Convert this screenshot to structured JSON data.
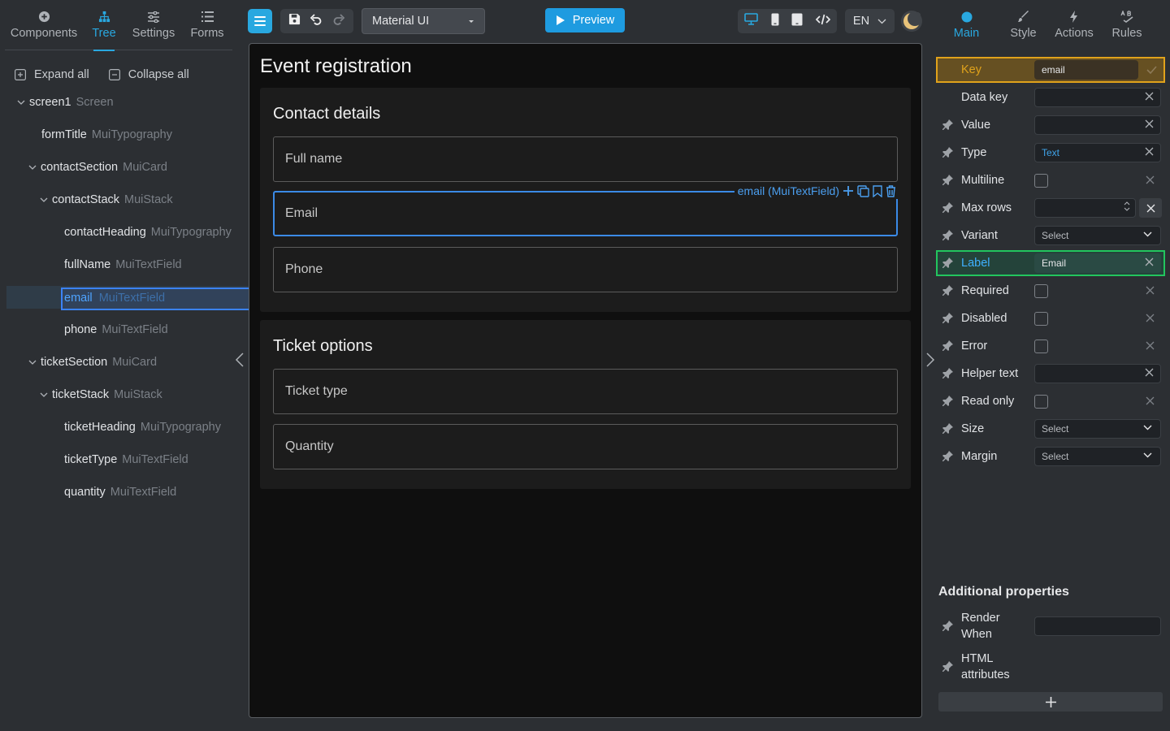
{
  "left_tabs": [
    {
      "label": "Components",
      "icon": "plus-circle-icon"
    },
    {
      "label": "Tree",
      "icon": "tree-icon"
    },
    {
      "label": "Settings",
      "icon": "sliders-icon"
    },
    {
      "label": "Forms",
      "icon": "list-icon"
    }
  ],
  "active_left_tab": "Tree",
  "tree_actions": {
    "expand_all": "Expand all",
    "collapse_all": "Collapse all"
  },
  "tree": [
    {
      "name": "screen1",
      "type": "Screen",
      "expanded": true
    },
    {
      "name": "formTitle",
      "type": "MuiTypography"
    },
    {
      "name": "contactSection",
      "type": "MuiCard",
      "expanded": true
    },
    {
      "name": "contactStack",
      "type": "MuiStack",
      "expanded": true
    },
    {
      "name": "contactHeading",
      "type": "MuiTypography"
    },
    {
      "name": "fullName",
      "type": "MuiTextField"
    },
    {
      "name": "email",
      "type": "MuiTextField",
      "selected": true
    },
    {
      "name": "phone",
      "type": "MuiTextField"
    },
    {
      "name": "ticketSection",
      "type": "MuiCard",
      "expanded": true
    },
    {
      "name": "ticketStack",
      "type": "MuiStack",
      "expanded": true
    },
    {
      "name": "ticketHeading",
      "type": "MuiTypography"
    },
    {
      "name": "ticketType",
      "type": "MuiTextField"
    },
    {
      "name": "quantity",
      "type": "MuiTextField"
    }
  ],
  "toolbar": {
    "library": "Material UI",
    "preview": "Preview",
    "language": "EN"
  },
  "canvas": {
    "form_title": "Event registration",
    "contact": {
      "heading": "Contact details",
      "fields": [
        "Full name",
        "Email",
        "Phone"
      ]
    },
    "ticket": {
      "heading": "Ticket options",
      "fields": [
        "Ticket type",
        "Quantity"
      ]
    },
    "selection_tag": "email (MuiTextField)"
  },
  "right_tabs": [
    {
      "label": "Main",
      "icon": "circle-icon"
    },
    {
      "label": "Style",
      "icon": "brush-icon"
    },
    {
      "label": "Actions",
      "icon": "lightning-icon"
    },
    {
      "label": "Rules",
      "icon": "rules-icon"
    }
  ],
  "active_right_tab": "Main",
  "props": {
    "key": {
      "label": "Key",
      "value": "email"
    },
    "data_key": {
      "label": "Data key",
      "value": ""
    },
    "value": {
      "label": "Value",
      "value": ""
    },
    "type": {
      "label": "Type",
      "value": "Text"
    },
    "multiline": {
      "label": "Multiline"
    },
    "max_rows": {
      "label": "Max rows"
    },
    "variant": {
      "label": "Variant",
      "value": "Select"
    },
    "label": {
      "label": "Label",
      "value": "Email"
    },
    "required": {
      "label": "Required"
    },
    "disabled": {
      "label": "Disabled"
    },
    "error": {
      "label": "Error"
    },
    "helper_text": {
      "label": "Helper text",
      "value": ""
    },
    "read_only": {
      "label": "Read only"
    },
    "size": {
      "label": "Size",
      "value": "Select"
    },
    "margin": {
      "label": "Margin",
      "value": "Select"
    }
  },
  "additional": {
    "heading": "Additional properties",
    "render_when": {
      "line1": "Render",
      "line2": "When"
    },
    "html_attributes": {
      "line1": "HTML",
      "line2": "attributes"
    }
  },
  "colors": {
    "accent": "#29a8e0",
    "key_highlight": "#e0a21b",
    "label_highlight": "#22c55e",
    "selection": "#3b82f6"
  }
}
